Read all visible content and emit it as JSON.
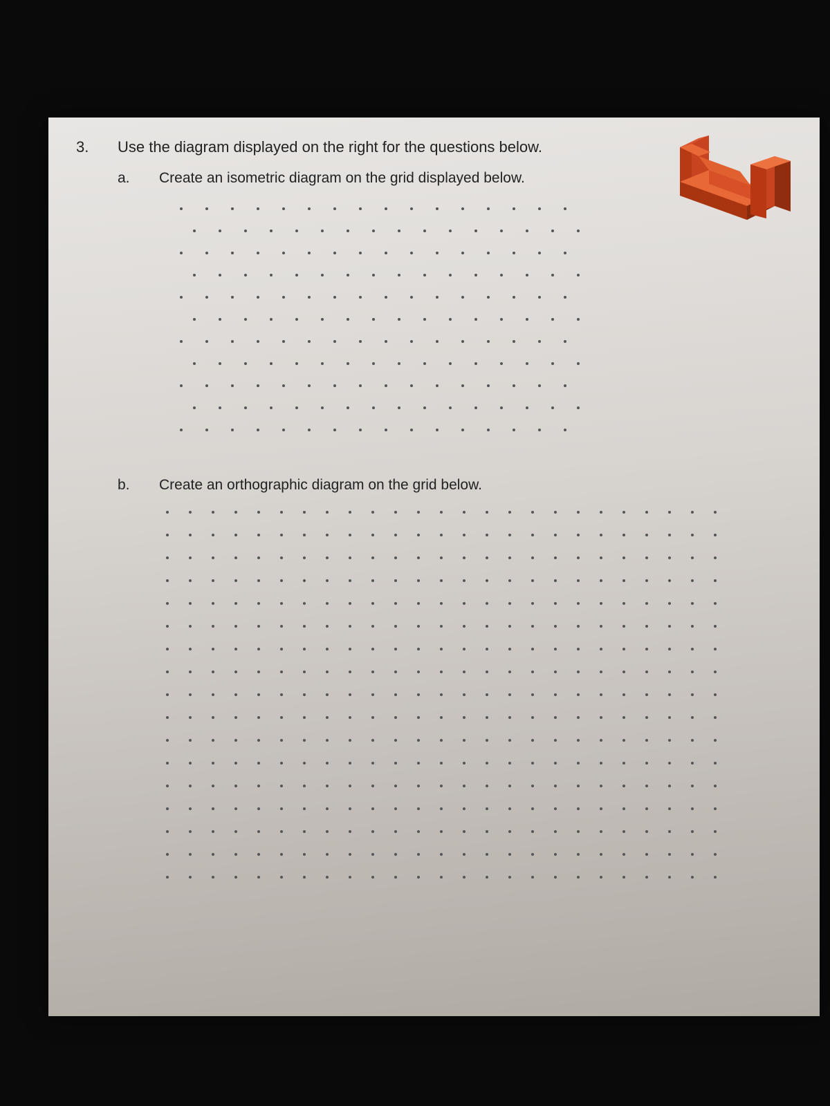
{
  "question": {
    "number": "3.",
    "text": "Use the diagram displayed on the right for the questions below.",
    "parts": {
      "a": {
        "label": "a.",
        "text": "Create an isometric diagram on the grid displayed below."
      },
      "b": {
        "label": "b.",
        "text": "Create an orthographic diagram on the grid below."
      }
    }
  },
  "grids": {
    "isometric": {
      "rows": 11,
      "cols": 16,
      "spacing": 37,
      "rowSpacing": 32
    },
    "orthographic": {
      "rows": 17,
      "cols": 25,
      "spacing": 33,
      "rowSpacing": 33
    }
  },
  "shape": {
    "description": "orange-u-shaped-block",
    "colors": {
      "top": "#e85a2a",
      "front": "#d44518",
      "side": "#a83410",
      "shadow": "#7a2408"
    }
  }
}
